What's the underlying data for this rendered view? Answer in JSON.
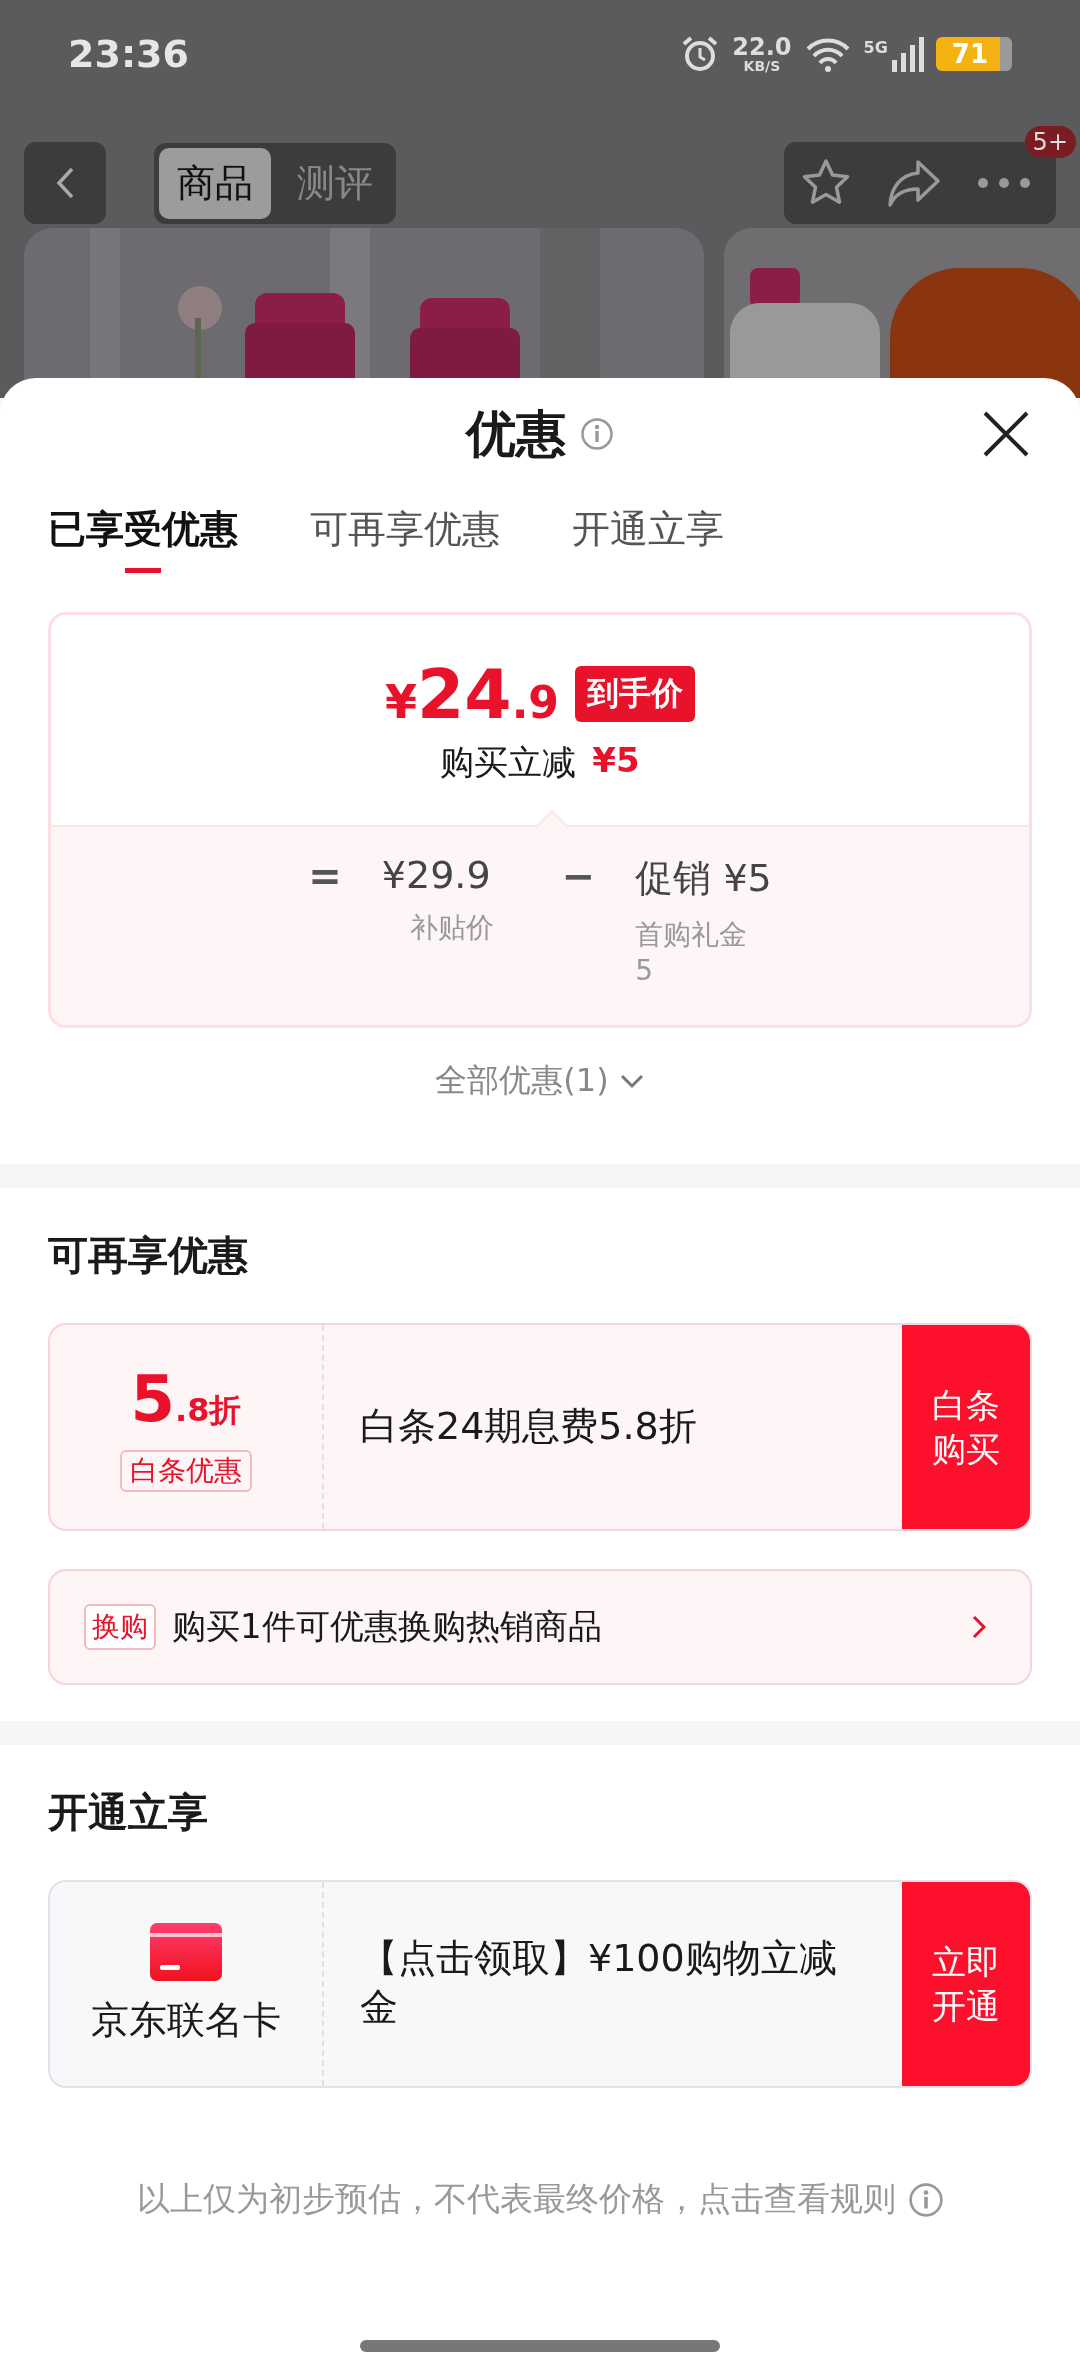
{
  "status_bar": {
    "time": "23:36",
    "net_speed": "22.0",
    "net_unit": "KB/S",
    "network": "5G",
    "battery": "71"
  },
  "nav": {
    "tabs": [
      {
        "label": "商品",
        "selected": true
      },
      {
        "label": "测评",
        "selected": false
      }
    ],
    "badge": "5+"
  },
  "sheet": {
    "title": "优惠",
    "tabs": [
      {
        "label": "已享受优惠",
        "selected": true
      },
      {
        "label": "可再享优惠",
        "selected": false
      },
      {
        "label": "开通立享",
        "selected": false
      }
    ],
    "summary": {
      "currency": "¥",
      "price_int": "24",
      "price_dec": ".9",
      "price_tag": "到手价",
      "saving_label": "购买立减",
      "saving_value": "¥5",
      "formula": [
        {
          "kind": "operator",
          "text": "="
        },
        {
          "kind": "term",
          "value": "¥29.9",
          "label": "补贴价"
        },
        {
          "kind": "operator",
          "text": "−"
        },
        {
          "kind": "term",
          "value": "促销 ¥5",
          "label": "首购礼金 5"
        }
      ]
    },
    "all_offers": "全部优惠(1)"
  },
  "sections": [
    {
      "title": "可再享优惠",
      "offers": [
        {
          "kind": "discount",
          "big": "5",
          "small": ".8折",
          "tag": "白条优惠",
          "desc": "白条24期息费5.8折",
          "action": "白条购买"
        }
      ],
      "exchange": {
        "tag": "换购",
        "text": "购买1件可优惠换购热销商品"
      }
    },
    {
      "title": "开通立享",
      "offers": [
        {
          "kind": "card",
          "name": "京东联名卡",
          "desc": "【点击领取】¥100购物立减金",
          "action": "立即开通"
        }
      ]
    }
  ],
  "footnote": "以上仅为初步预估，不代表最终价格，点击查看规则"
}
